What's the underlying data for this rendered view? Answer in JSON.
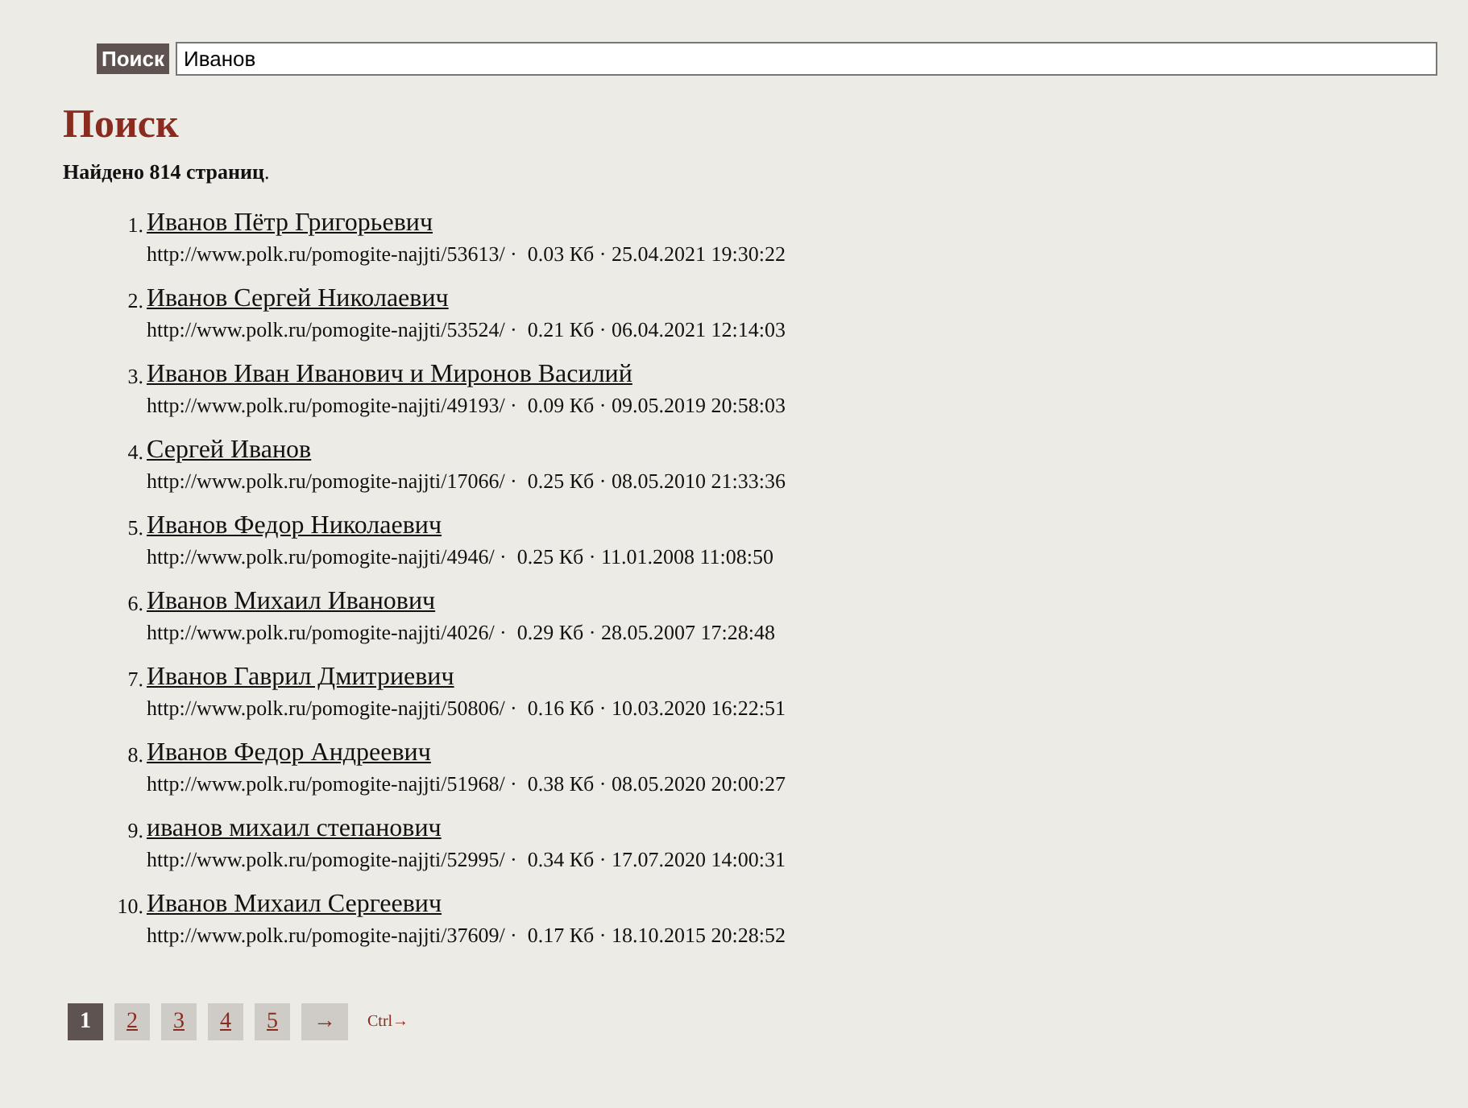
{
  "search": {
    "label": "Поиск",
    "value": "Иванов"
  },
  "heading": "Поиск",
  "found": "**Найдено 814 страниц**.",
  "results": [
    {
      "number": "1.",
      "title": "Иванов Пётр Григорьевич",
      "meta": "http://www.polk.ru/pomogite-najjti/53613/ ·  0.03 Кб · 25.04.2021 19:30:22"
    },
    {
      "number": "2.",
      "title": "Иванов Сергей Николаевич",
      "meta": "http://www.polk.ru/pomogite-najjti/53524/ ·  0.21 Кб · 06.04.2021 12:14:03"
    },
    {
      "number": "3.",
      "title": "Иванов Иван Иванович и Миронов Василий",
      "meta": "http://www.polk.ru/pomogite-najjti/49193/ ·  0.09 Кб · 09.05.2019 20:58:03"
    },
    {
      "number": "4.",
      "title": "Сергей Иванов",
      "meta": "http://www.polk.ru/pomogite-najjti/17066/ ·  0.25 Кб · 08.05.2010 21:33:36"
    },
    {
      "number": "5.",
      "title": "Иванов Федор Николаевич",
      "meta": "http://www.polk.ru/pomogite-najjti/4946/ ·  0.25 Кб · 11.01.2008 11:08:50"
    },
    {
      "number": "6.",
      "title": "Иванов Михаил Иванович",
      "meta": "http://www.polk.ru/pomogite-najjti/4026/ ·  0.29 Кб · 28.05.2007 17:28:48"
    },
    {
      "number": "7.",
      "title": "Иванов Гаврил Дмитриевич",
      "meta": "http://www.polk.ru/pomogite-najjti/50806/ ·  0.16 Кб · 10.03.2020 16:22:51"
    },
    {
      "number": "8.",
      "title": "Иванов Федор Андреевич",
      "meta": "http://www.polk.ru/pomogite-najjti/51968/ ·  0.38 Кб · 08.05.2020 20:00:27"
    },
    {
      "number": "9.",
      "title": "иванов михаил степанович",
      "meta": "http://www.polk.ru/pomogite-najjti/52995/ ·  0.34 Кб · 17.07.2020 14:00:31"
    },
    {
      "number": "10.",
      "title": "Иванов Михаил Сергеевич",
      "meta": "http://www.polk.ru/pomogite-najjti/37609/ ·  0.17 Кб · 18.10.2015 20:28:52"
    }
  ],
  "pagination": {
    "pages": [
      {
        "label": "1",
        "selected": true
      },
      {
        "label": "2",
        "selected": false
      },
      {
        "label": "3",
        "selected": false
      },
      {
        "label": "4",
        "selected": false
      },
      {
        "label": "5",
        "selected": false
      }
    ],
    "next": "→",
    "hint": "Ctrl→"
  }
}
